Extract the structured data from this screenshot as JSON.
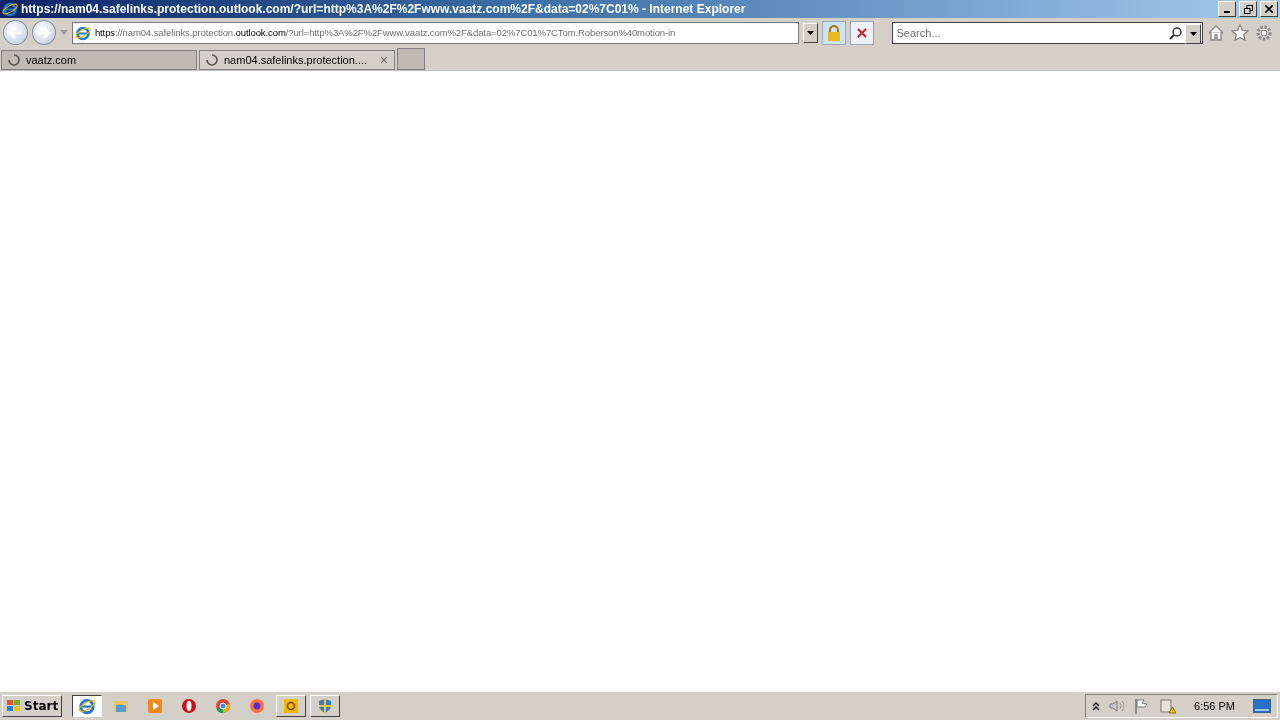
{
  "window": {
    "title": "https://nam04.safelinks.protection.outlook.com/?url=http%3A%2F%2Fwww.vaatz.com%2F&data=02%7C01% - Internet Explorer"
  },
  "address_bar": {
    "segments": [
      {
        "text": "https",
        "strong": true
      },
      {
        "text": "://nam04.safelinks.protection.",
        "strong": false
      },
      {
        "text": "outlook.com",
        "strong": true
      },
      {
        "text": "/?url=http%3A%2F%2Fwww.vaatz.com%2F&data=02%7C01%7CTom.Roberson%40motion-in",
        "strong": false
      }
    ]
  },
  "search": {
    "placeholder": "Search..."
  },
  "tabs": [
    {
      "label": "vaatz.com",
      "selected": false
    },
    {
      "label": "nam04.safelinks.protection....",
      "selected": true,
      "close": "×"
    }
  ],
  "taskbar": {
    "start": "Start",
    "apps": [
      {
        "kind": "ie",
        "selected": true,
        "running": true
      },
      {
        "kind": "folder",
        "selected": false,
        "running": false
      },
      {
        "kind": "media",
        "selected": false,
        "running": false
      },
      {
        "kind": "opera",
        "selected": false,
        "running": false
      },
      {
        "kind": "chrome",
        "selected": false,
        "running": false
      },
      {
        "kind": "firefox",
        "selected": false,
        "running": false
      },
      {
        "kind": "outlook",
        "selected": false,
        "running": true
      },
      {
        "kind": "shield",
        "selected": false,
        "running": true
      }
    ],
    "clock": "6:56 PM"
  }
}
